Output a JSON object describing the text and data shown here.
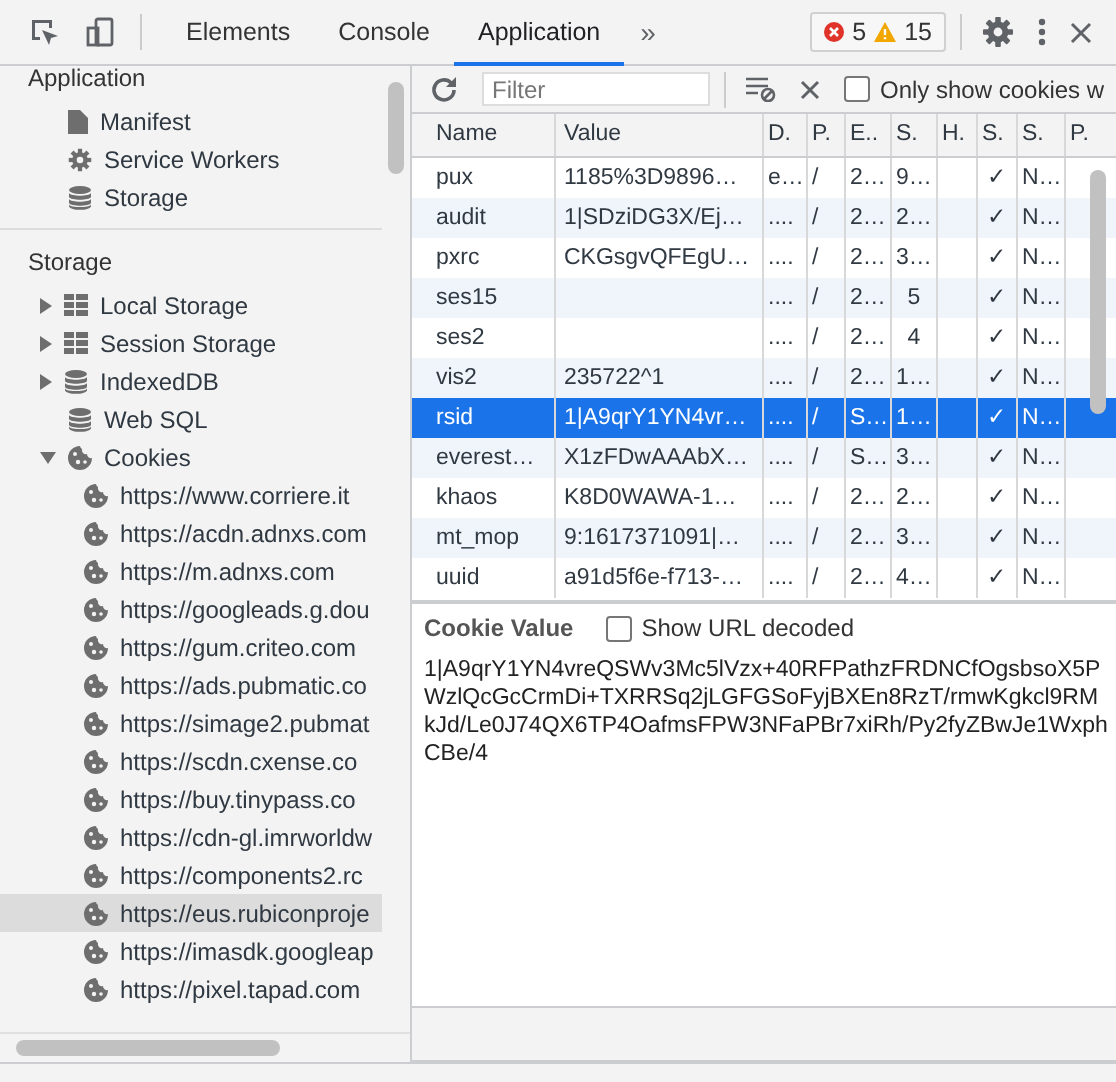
{
  "toolbar": {
    "tabs": [
      {
        "label": "Elements",
        "selected": false
      },
      {
        "label": "Console",
        "selected": false
      },
      {
        "label": "Application",
        "selected": true
      }
    ],
    "more": "»",
    "errors": "5",
    "warnings": "15"
  },
  "sidebar": {
    "sections": [
      {
        "title": "Application",
        "items": [
          {
            "label": "Manifest",
            "kind": "leaf"
          },
          {
            "label": "Service Workers",
            "kind": "leaf"
          },
          {
            "label": "Storage",
            "kind": "leaf"
          }
        ]
      },
      {
        "title": "Storage",
        "items": [
          {
            "label": "Local Storage",
            "kind": "group",
            "expanded": false
          },
          {
            "label": "Session Storage",
            "kind": "group",
            "expanded": false
          },
          {
            "label": "IndexedDB",
            "kind": "group",
            "expanded": false
          },
          {
            "label": "Web SQL",
            "kind": "leaf"
          },
          {
            "label": "Cookies",
            "kind": "group",
            "expanded": true,
            "children": [
              {
                "label": "https://www.corriere.it",
                "selected": false
              },
              {
                "label": "https://acdn.adnxs.com",
                "selected": false
              },
              {
                "label": "https://m.adnxs.com",
                "selected": false
              },
              {
                "label": "https://googleads.g.dou",
                "selected": false
              },
              {
                "label": "https://gum.criteo.com",
                "selected": false
              },
              {
                "label": "https://ads.pubmatic.co",
                "selected": false
              },
              {
                "label": "https://simage2.pubmat",
                "selected": false
              },
              {
                "label": "https://scdn.cxense.co",
                "selected": false
              },
              {
                "label": "https://buy.tinypass.co",
                "selected": false
              },
              {
                "label": "https://cdn-gl.imrworldw",
                "selected": false
              },
              {
                "label": "https://components2.rc",
                "selected": false
              },
              {
                "label": "https://eus.rubiconproje",
                "selected": true
              },
              {
                "label": "https://imasdk.googleap",
                "selected": false
              },
              {
                "label": "https://pixel.tapad.com",
                "selected": false
              }
            ]
          }
        ]
      }
    ]
  },
  "filter": {
    "placeholder": "Filter"
  },
  "only_show": {
    "label": "Only show cookies w",
    "checked": false
  },
  "table": {
    "columns": [
      "Name",
      "Value",
      "D.",
      "P.",
      "E..",
      "S.",
      "H.",
      "S.",
      "S.",
      "P."
    ],
    "rows": [
      {
        "cells": [
          "pux",
          "1185%3D9896…",
          "e…",
          "/",
          "2…",
          "9…",
          "",
          "✓",
          "N…"
        ],
        "selected": false
      },
      {
        "cells": [
          "audit",
          "1|SDziDG3X/Ej…",
          "....",
          "/",
          "2…",
          "2…",
          "",
          "✓",
          "N…"
        ],
        "selected": false
      },
      {
        "cells": [
          "pxrc",
          "CKGsgvQFEgU…",
          "....",
          "/",
          "2…",
          "3…",
          "",
          "✓",
          "N…"
        ],
        "selected": false
      },
      {
        "cells": [
          "ses15",
          "",
          "....",
          "/",
          "2…",
          "5",
          "",
          "✓",
          "N…"
        ],
        "selected": false
      },
      {
        "cells": [
          "ses2",
          "",
          "....",
          "/",
          "2…",
          "4",
          "",
          "✓",
          "N…"
        ],
        "selected": false
      },
      {
        "cells": [
          "vis2",
          "235722^1",
          "....",
          "/",
          "2…",
          "1…",
          "",
          "✓",
          "N…"
        ],
        "selected": false
      },
      {
        "cells": [
          "rsid",
          "1|A9qrY1YN4vr…",
          "....",
          "/",
          "S…",
          "1…",
          "",
          "✓",
          "N…"
        ],
        "selected": true
      },
      {
        "cells": [
          "everest…",
          "X1zFDwAAAbX…",
          "....",
          "/",
          "S…",
          "3…",
          "",
          "✓",
          "N…"
        ],
        "selected": false
      },
      {
        "cells": [
          "khaos",
          "K8D0WAWA-1…",
          "....",
          "/",
          "2…",
          "2…",
          "",
          "✓",
          "N…"
        ],
        "selected": false
      },
      {
        "cells": [
          "mt_mop",
          "9:1617371091|…",
          "....",
          "/",
          "2…",
          "3…",
          "",
          "✓",
          "N…"
        ],
        "selected": false
      },
      {
        "cells": [
          "uuid",
          "a91d5f6e-f713-…",
          "....",
          "/",
          "2…",
          "4…",
          "",
          "✓",
          "N…"
        ],
        "selected": false
      }
    ]
  },
  "value_pane": {
    "label": "Cookie Value",
    "decode": {
      "label": "Show URL decoded",
      "checked": false
    },
    "value": "1|A9qrY1YN4vreQSWv3Mc5lVzx+40RFPathzFRDNCfOgsbsoX5PWzlQcGcCrmDi+TXRRSq2jLGFGSoFyjBXEn8RzT/rmwKgkcl9RMkJd/Le0J74QX6TP4OafmsFPW3NFaPBr7xiRh/Py2fyZBwJe1WxphCBe/4"
  }
}
